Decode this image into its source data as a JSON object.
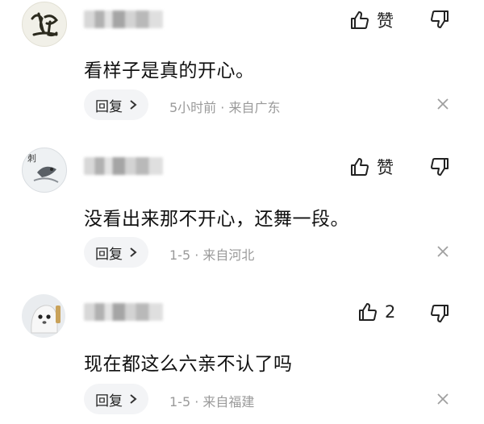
{
  "comments": [
    {
      "avatar": "calligraphy-avatar",
      "text": "看样子是真的开心。",
      "like_label": "赞",
      "reply_label": "回复",
      "time": "5小时前",
      "location": "来自广东"
    },
    {
      "avatar": "ink-bird-avatar",
      "text": "没看出来那不开心，还舞一段。",
      "like_label": "赞",
      "reply_label": "回复",
      "time": "1-5",
      "location": "来自河北"
    },
    {
      "avatar": "ghost-avatar",
      "text": "现在都这么六亲不认了吗",
      "like_label": "2",
      "reply_label": "回复",
      "time": "1-5",
      "location": "来自福建"
    }
  ],
  "separator": " · ",
  "icons": {
    "like": "thumbs-up-icon",
    "dislike": "thumbs-down-icon",
    "reply_arrow": "chevron-right-icon",
    "close": "close-icon"
  }
}
